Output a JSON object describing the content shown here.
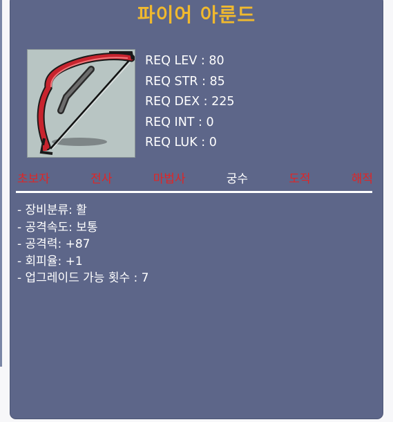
{
  "item": {
    "name": "파이어 아룬드",
    "icon": "bow-icon"
  },
  "requirements": [
    "REQ LEV : 80",
    "REQ STR : 85",
    "REQ DEX : 225",
    "REQ INT : 0",
    "REQ LUK : 0"
  ],
  "classes": [
    {
      "label": "초보자",
      "available": false
    },
    {
      "label": "전사",
      "available": false
    },
    {
      "label": "마법사",
      "available": false
    },
    {
      "label": "궁수",
      "available": true
    },
    {
      "label": "도적",
      "available": false
    },
    {
      "label": "해적",
      "available": false
    }
  ],
  "stats": [
    "- 장비분류: 활",
    "- 공격속도: 보통",
    "- 공격력: +87",
    "- 회피율: +1",
    "- 업그레이드 가능 횟수 : 7"
  ],
  "colors": {
    "panel": "#5d6689",
    "title": "#f0b92e",
    "unavailable_class": "#e02525",
    "available_class": "#ffffff"
  }
}
